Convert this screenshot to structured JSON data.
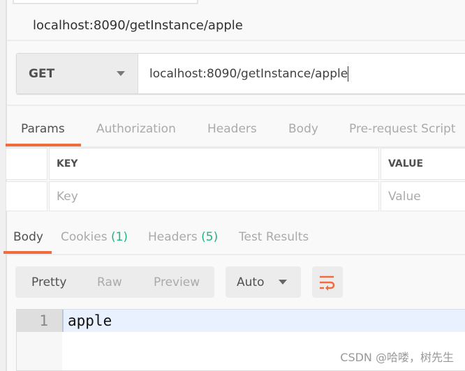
{
  "request": {
    "title": "localhost:8090/getInstance/apple",
    "method": "GET",
    "url": "localhost:8090/getInstance/apple"
  },
  "request_tabs": [
    {
      "label": "Params",
      "active": true
    },
    {
      "label": "Authorization"
    },
    {
      "label": "Headers"
    },
    {
      "label": "Body"
    },
    {
      "label": "Pre-request Script"
    }
  ],
  "params_table": {
    "headers": [
      "KEY",
      "VALUE"
    ],
    "placeholders": {
      "key": "Key",
      "value": "Value"
    }
  },
  "response_tabs": [
    {
      "label": "Body",
      "active": true
    },
    {
      "label": "Cookies",
      "count": "(1)"
    },
    {
      "label": "Headers",
      "count": "(5)"
    },
    {
      "label": "Test Results"
    }
  ],
  "view_modes": [
    "Pretty",
    "Raw",
    "Preview"
  ],
  "format": "Auto",
  "wrap_icon": "wrap-lines-icon",
  "body": {
    "line_number": "1",
    "content": "apple"
  },
  "watermark": "CSDN @哈喽，树先生",
  "colors": {
    "accent": "#f26b3a",
    "count": "#20b57f"
  }
}
